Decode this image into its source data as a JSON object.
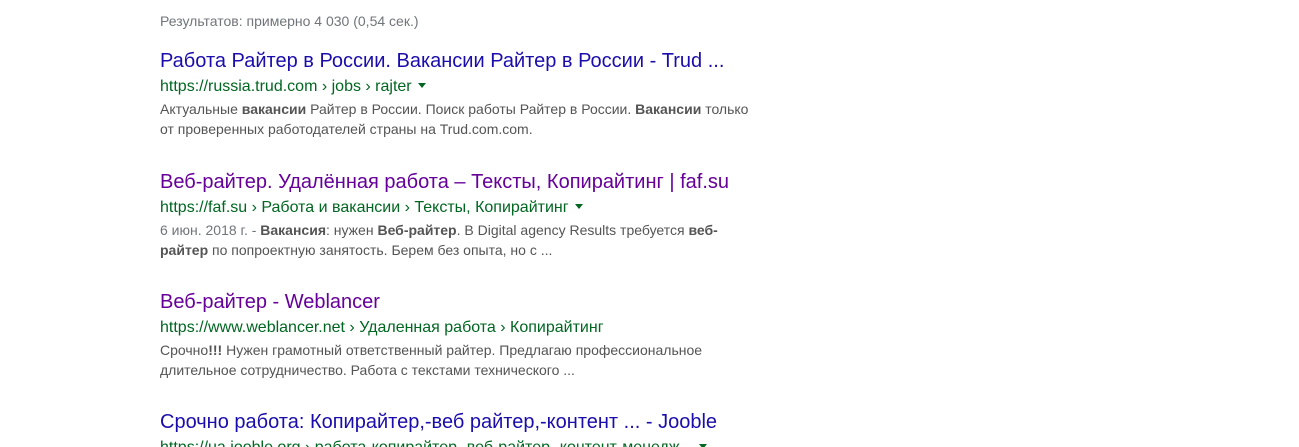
{
  "stats": "Результатов: примерно 4 030 (0,54 сек.)",
  "colors": {
    "title_unvisited": "#1a0dab",
    "title_visited": "#660099",
    "url": "#006621",
    "snippet": "#545454",
    "stats": "#70757a"
  },
  "results": [
    {
      "title": "Работа Райтер в России. Вакансии Райтер в России - Trud ...",
      "url": "https://russia.trud.com › jobs › rajter",
      "has_dropdown": true,
      "snippet": {
        "date": "",
        "parts": [
          {
            "text": "Актуальные ",
            "bold": false
          },
          {
            "text": "вакансии",
            "bold": true
          },
          {
            "text": " Райтер в России. Поиск работы Райтер в России. ",
            "bold": false
          },
          {
            "text": "Вакансии",
            "bold": true
          },
          {
            "text": " только",
            "bold": false
          },
          {
            "text": "\nот проверенных работодателей страны на Trud.com.com.",
            "bold": false
          }
        ]
      }
    },
    {
      "title": "Веб-райтер. Удалённая работа – Тексты, Копирайтинг | faf.su",
      "url": "https://faf.su › Работа и вакансии › Тексты, Копирайтинг",
      "has_dropdown": true,
      "snippet": {
        "date": "6 июн. 2018 г. - ",
        "parts": [
          {
            "text": "Вакансия",
            "bold": true
          },
          {
            "text": ": нужен ",
            "bold": false
          },
          {
            "text": "Веб-райтер",
            "bold": true
          },
          {
            "text": ". В Digital agency Results требуется ",
            "bold": false
          },
          {
            "text": "веб-",
            "bold": true
          },
          {
            "text": "\n",
            "bold": false
          },
          {
            "text": "райтер",
            "bold": true
          },
          {
            "text": " по попроектную занятость. Берем без опыта, но с ...",
            "bold": false
          }
        ]
      }
    },
    {
      "title": "Веб-райтер - Weblancer",
      "url": "https://www.weblancer.net › Удаленная работа › Копирайтинг",
      "has_dropdown": false,
      "snippet": {
        "date": "",
        "parts": [
          {
            "text": "Срочно",
            "bold": false
          },
          {
            "text": "!!!",
            "bold": true
          },
          {
            "text": " Нужен грамотный ответственный райтер. Предлагаю профессиональное",
            "bold": false
          },
          {
            "text": "\nдлительное сотрудничество. Работа с текстами технического ...",
            "bold": false
          }
        ]
      }
    },
    {
      "title": "Срочно работа: Копирайтер,-веб райтер,-контент ... - Jooble",
      "url": "https://ua.jooble.org › работа-копирайтер,-веб-райтер,-контент-менедж...",
      "has_dropdown": true,
      "snippet": {
        "date": "",
        "parts": []
      }
    }
  ]
}
